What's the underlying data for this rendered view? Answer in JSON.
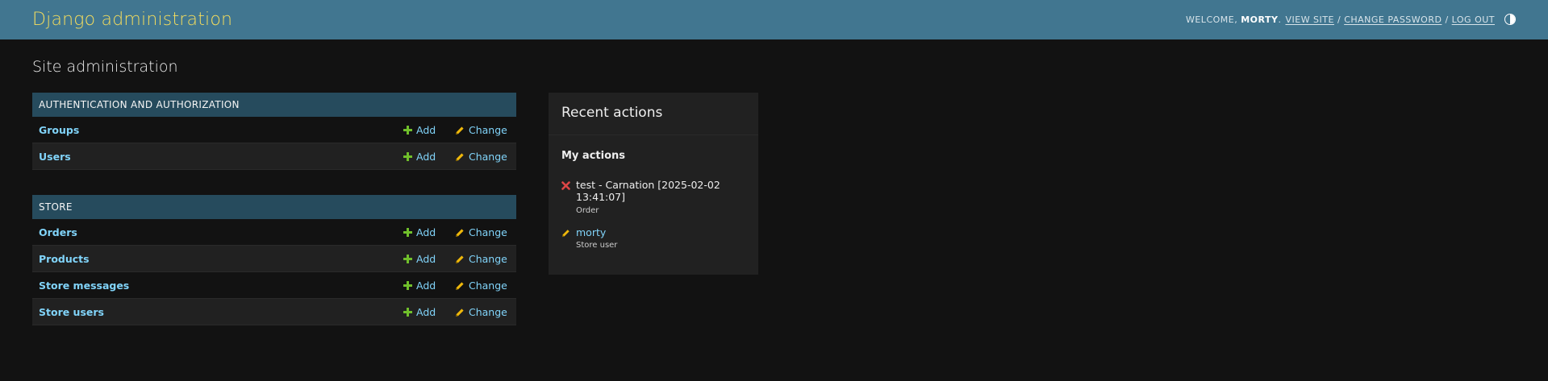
{
  "header": {
    "brand": "Django administration",
    "welcome": "Welcome,",
    "username": "morty",
    "view_site": "View site",
    "change_password": "Change password",
    "log_out": "Log out",
    "separator": "/",
    "theme_icon": "half-circle-theme-icon"
  },
  "page_title": "Site administration",
  "apps": [
    {
      "name": "Authentication and Authorization",
      "models": [
        {
          "name": "Groups",
          "add": "Add",
          "change": "Change"
        },
        {
          "name": "Users",
          "add": "Add",
          "change": "Change"
        }
      ]
    },
    {
      "name": "Store",
      "models": [
        {
          "name": "Orders",
          "add": "Add",
          "change": "Change"
        },
        {
          "name": "Products",
          "add": "Add",
          "change": "Change"
        },
        {
          "name": "Store messages",
          "add": "Add",
          "change": "Change"
        },
        {
          "name": "Store users",
          "add": "Add",
          "change": "Change"
        }
      ]
    }
  ],
  "recent_actions": {
    "title": "Recent actions",
    "subtitle": "My actions",
    "items": [
      {
        "title": "test - Carnation [2025-02-02 13:41:07]",
        "type": "Order",
        "icon": "delete-x-icon"
      },
      {
        "title": "morty",
        "type": "Store user",
        "icon": "pencil-icon"
      }
    ]
  },
  "colors": {
    "header_bg": "#417690",
    "brand": "#f5dd5d",
    "caption_bg": "#264b5d",
    "link": "#81d4fa",
    "add_icon": "#70bf2b",
    "change_icon": "#efb80b",
    "delete_icon": "#dd4646"
  }
}
